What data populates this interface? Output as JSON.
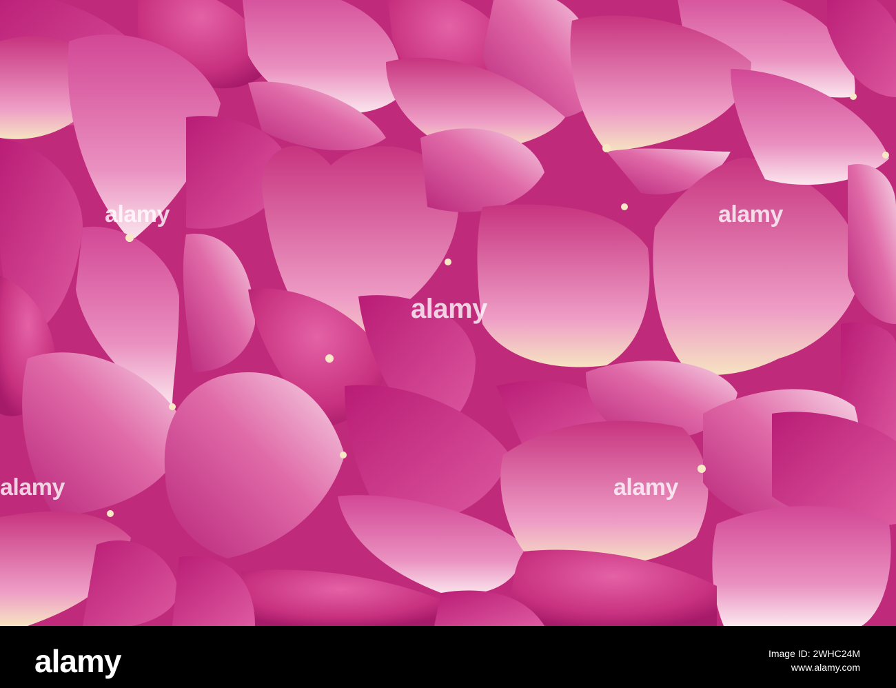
{
  "watermark": {
    "text": "alamy"
  },
  "footer": {
    "logo": "alamy",
    "image_id_label": "Image ID: 2WHC24M",
    "site": "www.alamy.com"
  },
  "colors": {
    "deep_magenta": "#b51f74",
    "rose_pink": "#d9478f",
    "light_pink": "#f2a8cc",
    "petal_base_cream": "#f7e9c6",
    "footer_background": "#000000"
  }
}
